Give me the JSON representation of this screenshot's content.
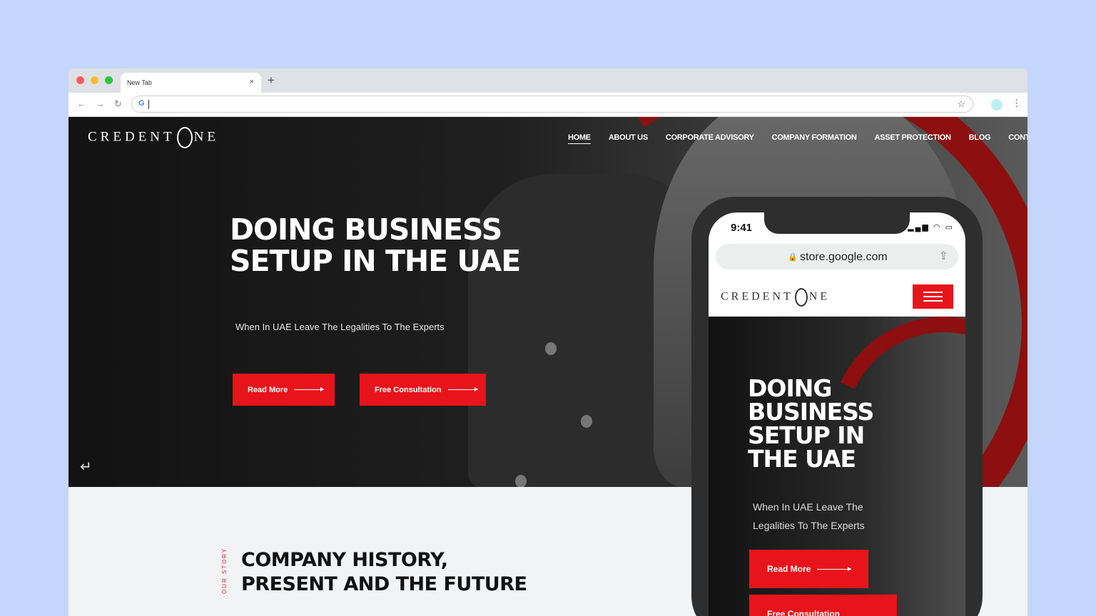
{
  "browser": {
    "tab_title": "New Tab",
    "tab_close": "×",
    "new_tab": "+",
    "address_value": "",
    "icons": {
      "back": "←",
      "forward": "→",
      "reload": "↻",
      "google": "G",
      "star": "☆",
      "kebab": "⋮"
    }
  },
  "site": {
    "logo_left": "CREDENT",
    "logo_right": "NE",
    "nav": [
      {
        "label": "HOME",
        "active": true
      },
      {
        "label": "ABOUT US"
      },
      {
        "label": "CORPORATE ADVISORY"
      },
      {
        "label": "COMPANY FORMATION"
      },
      {
        "label": "ASSET PROTECTION"
      },
      {
        "label": "BLOG"
      },
      {
        "label": "CONTACT"
      }
    ],
    "hero": {
      "title": "DOING BUSINESS SETUP IN THE UAE",
      "subtitle": "When In UAE Leave The Legalities To The Experts",
      "read_more": "Read More",
      "free_consultation": "Free Consultation",
      "return_icon": "↵"
    },
    "story": {
      "kicker": "OUR STORY",
      "title": "COMPANY HISTORY, PRESENT AND THE FUTURE"
    }
  },
  "phone": {
    "time": "9:41",
    "signal": "▂▄▆ ◠ ▭",
    "lock": "🔒",
    "url": "store.google.com",
    "share": "⇪",
    "logo_left": "CREDENT",
    "logo_right": "NE",
    "hero_title": "DOING BUSINESS SETUP IN THE UAE",
    "hero_subtitle": "When In UAE Leave The Legalities To The Experts",
    "read_more": "Read More",
    "free_consultation": "Free Consultation"
  },
  "colors": {
    "accent_red": "#e8141b",
    "arc_red": "#8d0f0f",
    "page_bg": "#c4d6fb"
  }
}
